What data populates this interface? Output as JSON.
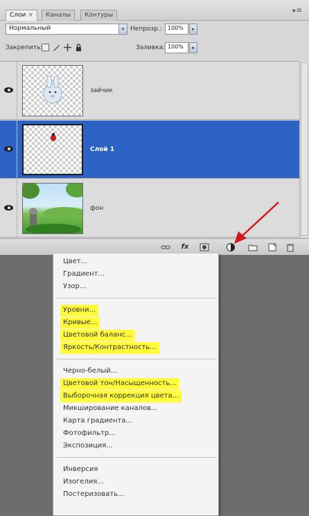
{
  "panel": {
    "tabs": [
      {
        "label": "Слои",
        "close": "×"
      },
      {
        "label": "Каналы"
      },
      {
        "label": "Контуры"
      }
    ],
    "menu_glyph": "▸≡",
    "blend_mode": "Нормальный",
    "opacity_label": "Непрозр.:",
    "opacity_value": "100%",
    "lock_label": "Закрепить:",
    "fill_label": "Заливка:",
    "fill_value": "100%",
    "spinner_glyph": "▸",
    "dropdown_glyph": "▾"
  },
  "layers": [
    {
      "name": "зайчик",
      "selected": false,
      "thumb": "bunny"
    },
    {
      "name": "Слой 1",
      "selected": true,
      "thumb": "transparent"
    },
    {
      "name": "фон",
      "selected": false,
      "thumb": "scene"
    }
  ],
  "bottombar": {
    "icons": [
      "link-icon",
      "fx-icon",
      "mask-icon",
      "adjustment-icon",
      "group-icon",
      "new-layer-icon",
      "trash-icon"
    ],
    "fx_label": "fx"
  },
  "menu": {
    "group1": [
      "Цвет...",
      "Градиент...",
      "Узор..."
    ],
    "group2": [
      "Уровни...",
      "Кривые...",
      "Цветовой баланс...",
      "Яркость/Контрастность..."
    ],
    "group3": [
      "Черно-белый...",
      "Цветовой тон/Насыщенность...",
      "Выборочная коррекция цвета...",
      "Микширование каналов...",
      "Карта градиента...",
      "Фотофильтр...",
      "Экспозиция..."
    ],
    "group4": [
      "Инверсия",
      "Изогелия...",
      "Постеризовать..."
    ]
  },
  "colors": {
    "highlight": "#fff200",
    "selection": "#2c63c4",
    "arrow": "#d01818"
  }
}
